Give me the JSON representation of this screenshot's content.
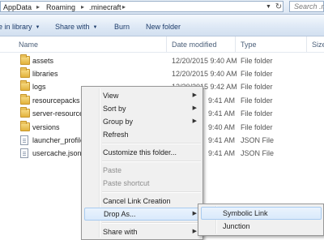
{
  "address": {
    "crumbs": [
      "AppData",
      "Roaming",
      ".minecraft"
    ]
  },
  "search": {
    "placeholder": "Search .m"
  },
  "toolbar": {
    "include_library": "e in library",
    "share_with": "Share with",
    "burn": "Burn",
    "new_folder": "New folder"
  },
  "columns": {
    "name": "Name",
    "date_modified": "Date modified",
    "type": "Type",
    "size": "Size"
  },
  "files": [
    {
      "name": "assets",
      "date": "12/20/2015 9:40 AM",
      "type": "File folder",
      "icon": "folder-icon"
    },
    {
      "name": "libraries",
      "date": "12/20/2015 9:40 AM",
      "type": "File folder",
      "icon": "folder-icon"
    },
    {
      "name": "logs",
      "date": "12/20/2015 9:42 AM",
      "type": "File folder",
      "icon": "folder-icon"
    },
    {
      "name": "resourcepacks",
      "date": "9:41 AM",
      "type": "File folder",
      "icon": "folder-icon"
    },
    {
      "name": "server-resource-",
      "date": "9:41 AM",
      "type": "File folder",
      "icon": "folder-icon"
    },
    {
      "name": "versions",
      "date": "9:40 AM",
      "type": "File folder",
      "icon": "folder-icon"
    },
    {
      "name": "launcher_profile",
      "date": "9:41 AM",
      "type": "JSON File",
      "icon": "file-icon"
    },
    {
      "name": "usercache.json",
      "date": "9:41 AM",
      "type": "JSON File",
      "icon": "file-icon"
    }
  ],
  "context_menu": {
    "view": "View",
    "sort_by": "Sort by",
    "group_by": "Group by",
    "refresh": "Refresh",
    "customize": "Customize this folder...",
    "paste": "Paste",
    "paste_shortcut": "Paste shortcut",
    "cancel_link": "Cancel Link Creation",
    "drop_as": "Drop As...",
    "share_with": "Share with"
  },
  "submenu": {
    "symbolic_link": "Symbolic Link",
    "junction": "Junction"
  }
}
